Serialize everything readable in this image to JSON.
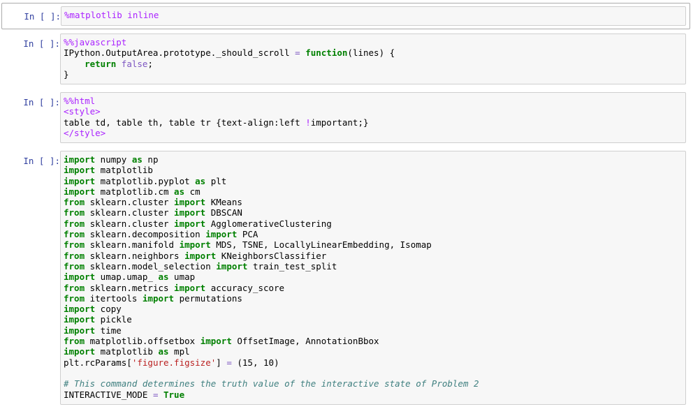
{
  "cells": [
    {
      "prompt": "In [ ]:",
      "lines": [
        "%matplotlib inline"
      ]
    },
    {
      "prompt": "In [ ]:",
      "lines": [
        "%%javascript",
        "IPython.OutputArea.prototype._should_scroll = function(lines) {",
        "    return false;",
        "}"
      ]
    },
    {
      "prompt": "In [ ]:",
      "lines": [
        "%%html",
        "<style>",
        "table td, table th, table tr {text-align:left !important;}",
        "</style>"
      ]
    },
    {
      "prompt": "In [ ]:",
      "lines": [
        "import numpy as np",
        "import matplotlib",
        "import matplotlib.pyplot as plt",
        "import matplotlib.cm as cm",
        "from sklearn.cluster import KMeans",
        "from sklearn.cluster import DBSCAN",
        "from sklearn.cluster import AgglomerativeClustering",
        "from sklearn.decomposition import PCA",
        "from sklearn.manifold import MDS, TSNE, LocallyLinearEmbedding, Isomap",
        "from sklearn.neighbors import KNeighborsClassifier",
        "from sklearn.model_selection import train_test_split",
        "import umap.umap_ as umap",
        "from sklearn.metrics import accuracy_score",
        "from itertools import permutations",
        "import copy",
        "import pickle",
        "import time",
        "from matplotlib.offsetbox import OffsetImage, AnnotationBbox",
        "import matplotlib as mpl",
        "plt.rcParams['figure.figsize'] = (15, 10)",
        "",
        "# This command determines the truth value of the interactive state of Problem 2",
        "INTERACTIVE_MODE = True"
      ]
    }
  ]
}
